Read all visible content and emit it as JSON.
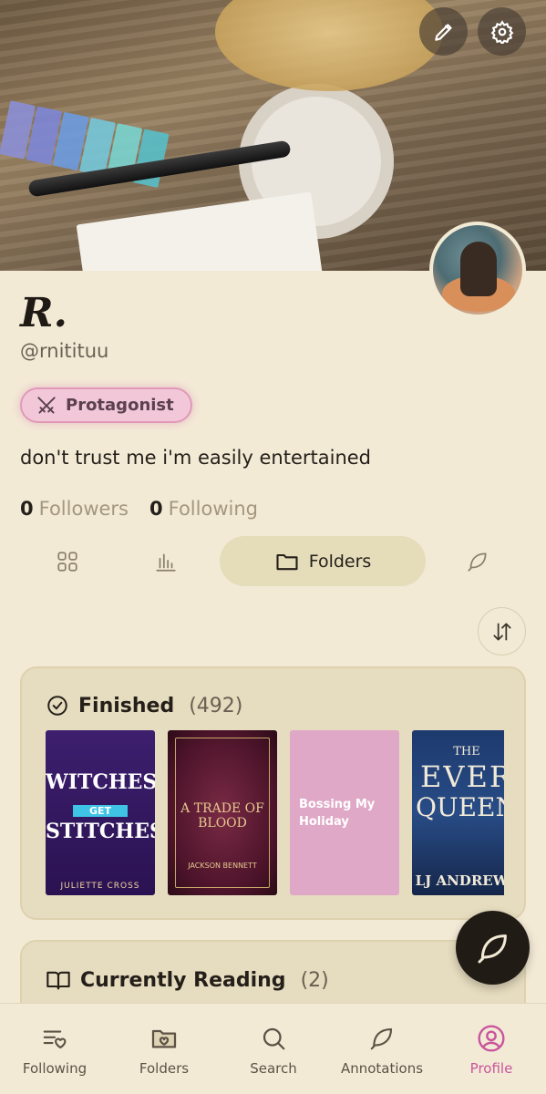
{
  "profile": {
    "name": "R.",
    "handle": "@rnitituu",
    "badge": "Protagonist",
    "bio": "don't trust me i'm easily entertained",
    "followers_count": "0",
    "followers_label": "Followers",
    "following_count": "0",
    "following_label": "Following"
  },
  "tabs": {
    "active_label": "Folders"
  },
  "folders": [
    {
      "title": "Finished",
      "count": "(492)",
      "books": [
        {
          "line1": "WITCHES",
          "line2": "GET",
          "line3": "STITCHES",
          "author": "JULIETTE CROSS"
        },
        {
          "line1": "A TRADE OF BLOOD",
          "author": "JACKSON BENNETT"
        },
        {
          "title": "Bossing My Holiday"
        },
        {
          "line1": "THE",
          "line2": "EVER",
          "line3": "QUEEN",
          "author": "LJ ANDREWS"
        }
      ]
    },
    {
      "title": "Currently Reading",
      "count": "(2)"
    }
  ],
  "nav": {
    "following": "Following",
    "folders": "Folders",
    "search": "Search",
    "annotations": "Annotations",
    "profile": "Profile"
  },
  "colors": {
    "background": "#f3ead6",
    "accent_pink": "#c9559d",
    "tab_active": "#e5dcba",
    "card": "#e6dcbf"
  }
}
